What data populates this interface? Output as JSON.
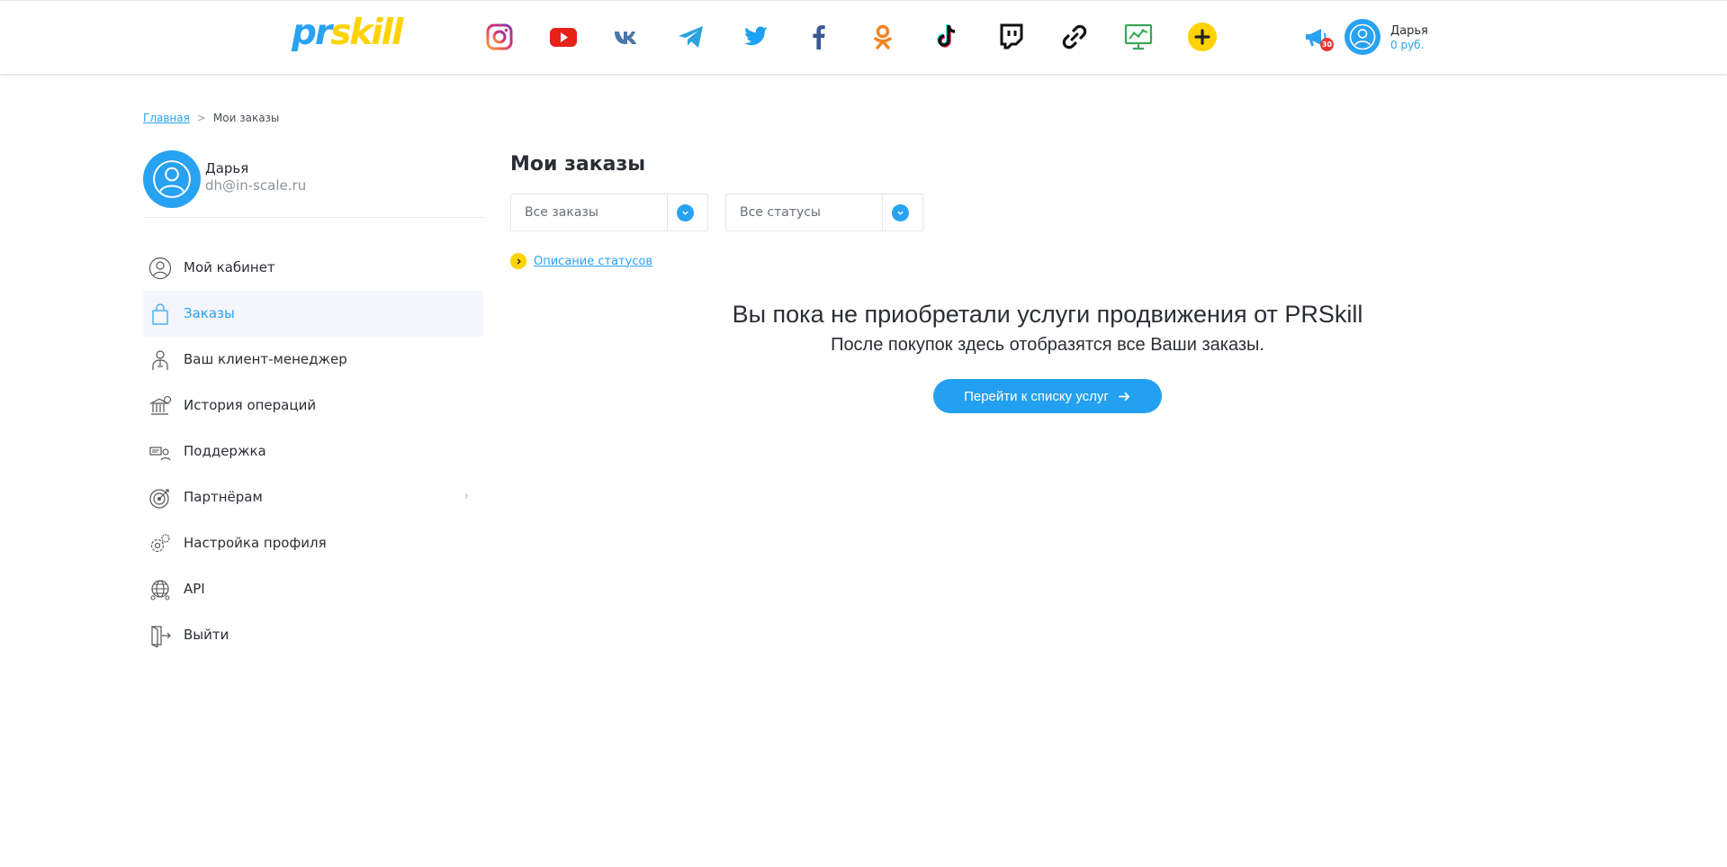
{
  "header": {
    "logo_pr": "pr",
    "logo_skill": "skill",
    "socials": [
      {
        "icon": "instagram-icon"
      },
      {
        "icon": "youtube-icon"
      },
      {
        "icon": "vk-icon"
      },
      {
        "icon": "telegram-icon"
      },
      {
        "icon": "twitter-icon"
      },
      {
        "icon": "facebook-icon"
      },
      {
        "icon": "odnoklassniki-icon"
      },
      {
        "icon": "tiktok-icon"
      },
      {
        "icon": "twitch-icon"
      },
      {
        "icon": "link-icon"
      },
      {
        "icon": "analytics-icon"
      },
      {
        "icon": "add-icon"
      }
    ],
    "notifications_count": "30",
    "user_name": "Дарья",
    "user_balance": "0 руб."
  },
  "breadcrumb": {
    "home": "Главная",
    "separator": ">",
    "current": "Мои заказы"
  },
  "profile": {
    "name": "Дарья",
    "email": "dh@in-scale.ru"
  },
  "sidebar": {
    "items": [
      {
        "label": "Мой кабинет",
        "icon": "user-icon",
        "active": false
      },
      {
        "label": "Заказы",
        "icon": "shopping-bag-icon",
        "active": true
      },
      {
        "label": "Ваш клиент-менеджер",
        "icon": "manager-icon",
        "active": false
      },
      {
        "label": "История операций",
        "icon": "bank-icon",
        "active": false
      },
      {
        "label": "Поддержка",
        "icon": "support-icon",
        "active": false
      },
      {
        "label": "Партнёрам",
        "icon": "target-icon",
        "active": false,
        "chevron": "›"
      },
      {
        "label": "Настройка профиля",
        "icon": "settings-icon",
        "active": false
      },
      {
        "label": "API",
        "icon": "api-globe-icon",
        "active": false
      },
      {
        "label": "Выйти",
        "icon": "logout-icon",
        "active": false
      }
    ]
  },
  "main": {
    "title": "Мои заказы",
    "filter_orders": "Все заказы",
    "filter_status": "Все статусы",
    "status_link": "Описание статусов",
    "empty_title": "Вы пока не приобретали услуги продвижения от PRSkill",
    "empty_subtitle": "После покупок здесь отобразятся все Ваши заказы.",
    "cta_label": "Перейти к списку услуг"
  },
  "colors": {
    "accent": "#28a2f2",
    "yellow": "#ffd200",
    "badge": "#e53935",
    "text": "#2b2e35"
  }
}
